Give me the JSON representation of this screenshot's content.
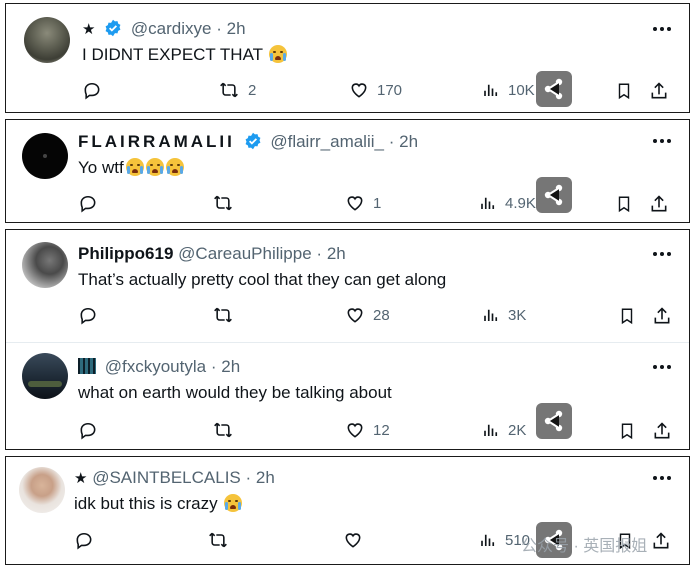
{
  "posts": [
    {
      "star": "★",
      "name": "",
      "handle": "@cardixye",
      "dot": "·",
      "time": "2h",
      "text": "I DIDNT EXPECT THAT",
      "emoji_count": 1,
      "verified": true,
      "reply_count": "",
      "retweet_count": "2",
      "like_count": "170",
      "view_count": "10K"
    },
    {
      "star": "",
      "name": "FLAIRRAMALII",
      "handle": "@flairr_amalii_",
      "dot": "·",
      "time": "2h",
      "text": "Yo wtf",
      "emoji_count": 3,
      "verified": true,
      "reply_count": "",
      "retweet_count": "",
      "like_count": "1",
      "view_count": "4.9K"
    },
    {
      "star": "",
      "name": "Philippo619",
      "handle": "@CareauPhilippe",
      "dot": "·",
      "time": "2h",
      "text": "That’s actually pretty cool that they can get along",
      "emoji_count": 0,
      "verified": false,
      "reply_count": "",
      "retweet_count": "",
      "like_count": "28",
      "view_count": "3K"
    },
    {
      "star": "",
      "name": "",
      "handle": "@fxckyoutyla",
      "dot": "·",
      "time": "2h",
      "text": "what on earth would they be talking about",
      "emoji_count": 0,
      "verified": false,
      "reply_count": "",
      "retweet_count": "",
      "like_count": "12",
      "view_count": "2K"
    },
    {
      "star": "★",
      "name": "",
      "handle": "@SAINTBELCALIS",
      "dot": "·",
      "time": "2h",
      "text": "idk but this is crazy",
      "emoji_count": 1,
      "verified": false,
      "reply_count": "",
      "retweet_count": "",
      "like_count": "",
      "view_count": "510"
    }
  ],
  "watermark": "公众号 · 英国报姐",
  "colors": {
    "verified": "#1d9bf0",
    "muted": "#536471",
    "text": "#0f1419"
  },
  "icons": [
    "reply-icon",
    "retweet-icon",
    "like-icon",
    "views-icon",
    "bookmark-icon",
    "share-icon",
    "more-icon",
    "verified-icon"
  ]
}
